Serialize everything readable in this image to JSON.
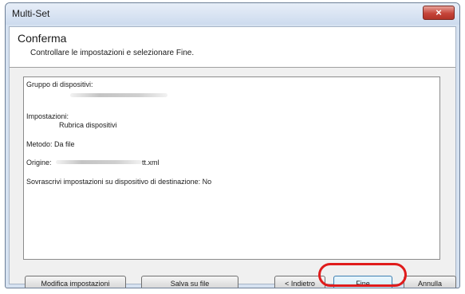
{
  "window": {
    "title": "Multi-Set",
    "close_icon": "×"
  },
  "header": {
    "title": "Conferma",
    "subtitle": "Controllare le impostazioni e selezionare Fine."
  },
  "summary": {
    "device_group_label": "Gruppo di dispositivi:",
    "settings_label": "Impostazioni:",
    "settings_value": "Rubrica dispositivi",
    "method_line": "Metodo: Da file",
    "origin_label": "Origine:",
    "origin_suffix": "tt.xml",
    "overwrite_line": "Sovrascrivi impostazioni su dispositivo di destinazione: No"
  },
  "buttons": {
    "edit_settings": "Modifica impostazioni",
    "save_to_file": "Salva su file",
    "back": "< Indietro",
    "finish": "Fine",
    "cancel": "Annulla"
  },
  "colors": {
    "highlight": "#e01b1b"
  }
}
